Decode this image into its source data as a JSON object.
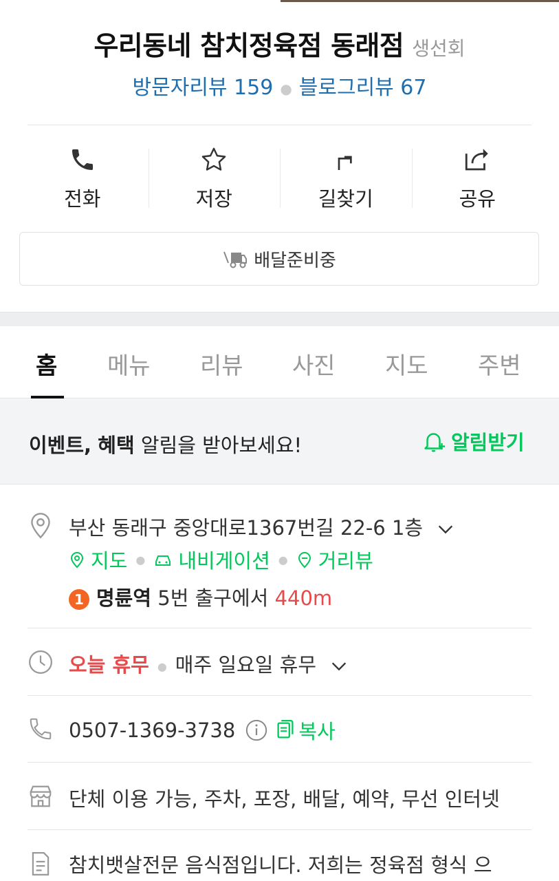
{
  "place": {
    "name": "우리동네 참치정육점 동래점",
    "category": "생선회",
    "visitor_reviews": "방문자리뷰 159",
    "blog_reviews": "블로그리뷰 67"
  },
  "actions": [
    {
      "label": "전화",
      "icon": "phone-icon"
    },
    {
      "label": "저장",
      "icon": "star-icon"
    },
    {
      "label": "길찾기",
      "icon": "directions-icon"
    },
    {
      "label": "공유",
      "icon": "share-icon"
    }
  ],
  "delivery": {
    "label": "배달준비중",
    "icon": "delivery-truck-icon"
  },
  "tabs": [
    "홈",
    "메뉴",
    "리뷰",
    "사진",
    "지도",
    "주변"
  ],
  "active_tab": "홈",
  "alert": {
    "bold1": "이벤트,",
    "bold2": "혜택",
    "text": "알림을 받아보세요!",
    "button": "알림받기"
  },
  "address": {
    "text": "부산 동래구 중앙대로1367번길 22-6 1층",
    "links": {
      "map": "지도",
      "navigation": "내비게이션",
      "streetview": "거리뷰"
    },
    "subway_line": "1",
    "station": "명륜역",
    "exit_text": "5번 출구에서",
    "distance": "440m"
  },
  "hours": {
    "status": "오늘 휴무",
    "detail": "매주 일요일 휴무"
  },
  "phone": {
    "number": "0507-1369-3738",
    "copy": "복사"
  },
  "facilities": "단체 이용 가능, 주차, 포장, 배달, 예약, 무선 인터넷",
  "description": "참치뱃살전문 음식점입니다. 저희는 정육점 형식 으",
  "colors": {
    "green": "#03c75a",
    "blue": "#1f6fb0",
    "red": "#e64a4a",
    "line1": "#f26522"
  }
}
